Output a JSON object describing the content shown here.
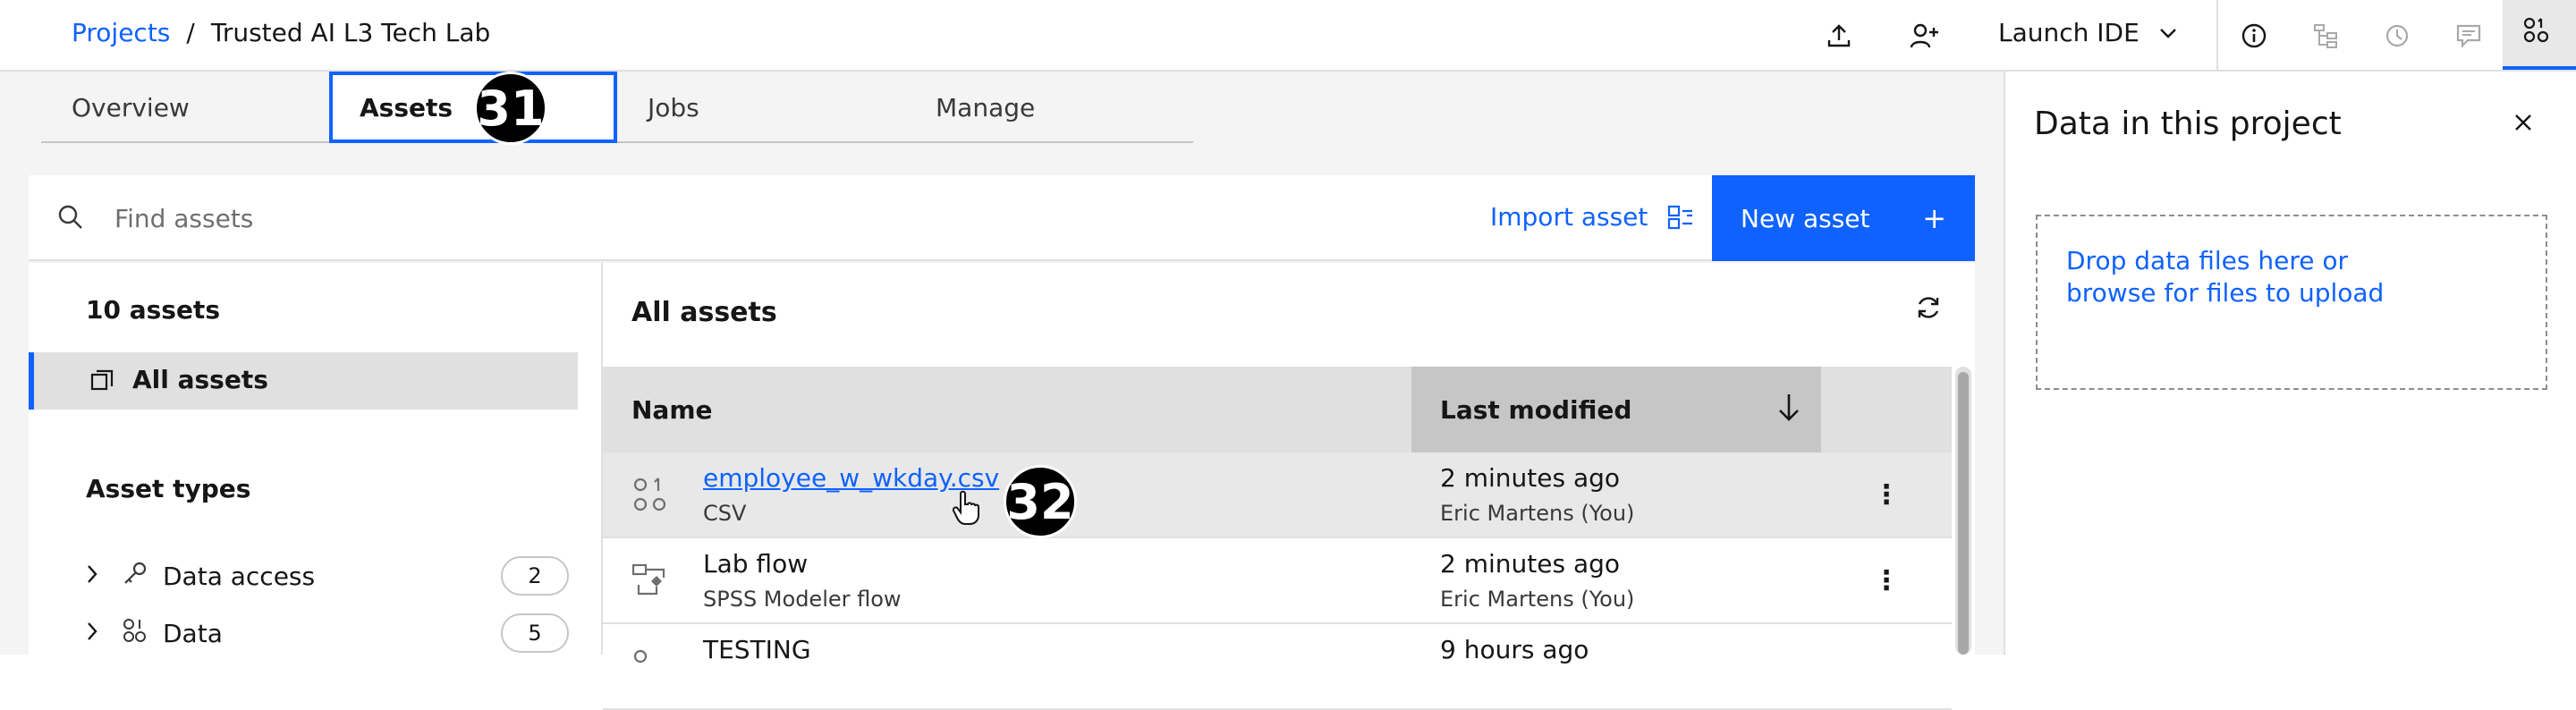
{
  "breadcrumb": {
    "projects": "Projects",
    "separator": "/",
    "project": "Trusted AI L3 Tech Lab"
  },
  "toolbar": {
    "launch_ide": "Launch IDE"
  },
  "tabs": [
    {
      "label": "Overview"
    },
    {
      "label": "Assets"
    },
    {
      "label": "Jobs"
    },
    {
      "label": "Manage"
    }
  ],
  "annotations": {
    "tab_badge": "31",
    "row_badge": "32"
  },
  "search": {
    "placeholder": "Find assets"
  },
  "actions": {
    "import": "Import asset",
    "new": "New asset",
    "new_icon": "+"
  },
  "left": {
    "count": "10 assets",
    "all": "All assets",
    "types_title": "Asset types",
    "types": [
      {
        "label": "Data access",
        "count": "2"
      },
      {
        "label": "Data",
        "count": "5"
      }
    ]
  },
  "main": {
    "title": "All assets",
    "col_name": "Name",
    "col_modified": "Last modified",
    "rows": [
      {
        "name": "employee_w_wkday.csv",
        "type": "CSV",
        "time": "2 minutes ago",
        "by": "Eric Martens (You)"
      },
      {
        "name": "Lab flow",
        "type": "SPSS Modeler flow",
        "time": "2 minutes ago",
        "by": "Eric Martens (You)"
      },
      {
        "name": "TESTING",
        "type": "",
        "time": "9 hours ago",
        "by": ""
      }
    ]
  },
  "right": {
    "title": "Data in this project",
    "drop_line1": "Drop data files here or",
    "drop_line2": "browse for files to upload"
  },
  "colors": {
    "accent": "#0f62fe",
    "hover": "#e8e8e8",
    "header": "#e0e0e0"
  }
}
